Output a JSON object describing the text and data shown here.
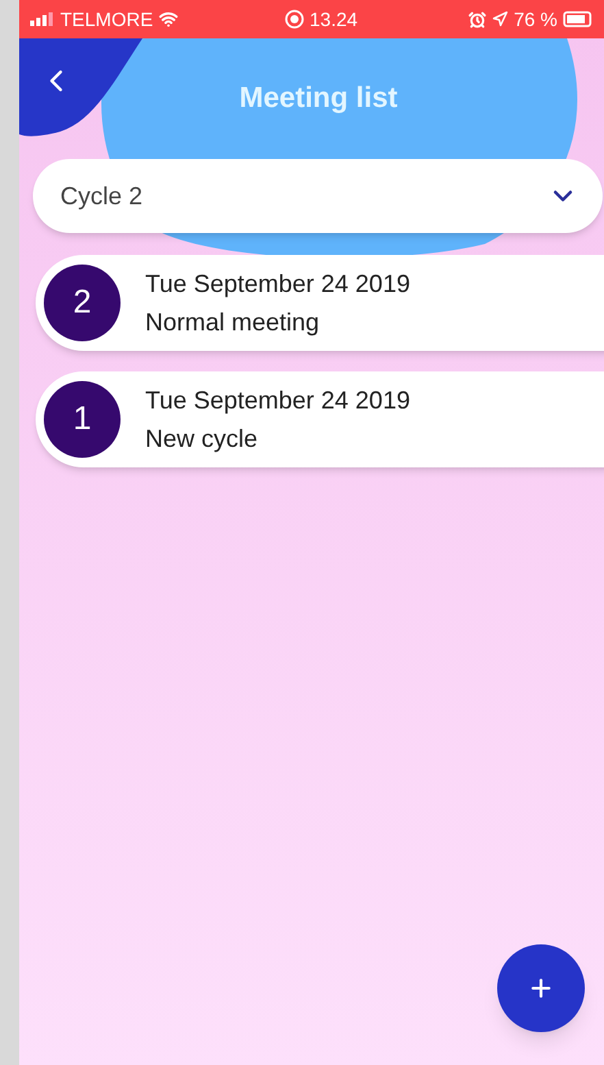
{
  "status_bar": {
    "carrier": "TELMORE",
    "time": "13.24",
    "battery": "76 %"
  },
  "header": {
    "title": "Meeting list"
  },
  "cycle_select": {
    "value": "Cycle 2"
  },
  "meetings": [
    {
      "number": "2",
      "date": "Tue September 24 2019",
      "name": "Normal meeting"
    },
    {
      "number": "1",
      "date": "Tue September 24 2019",
      "name": "New cycle"
    }
  ]
}
